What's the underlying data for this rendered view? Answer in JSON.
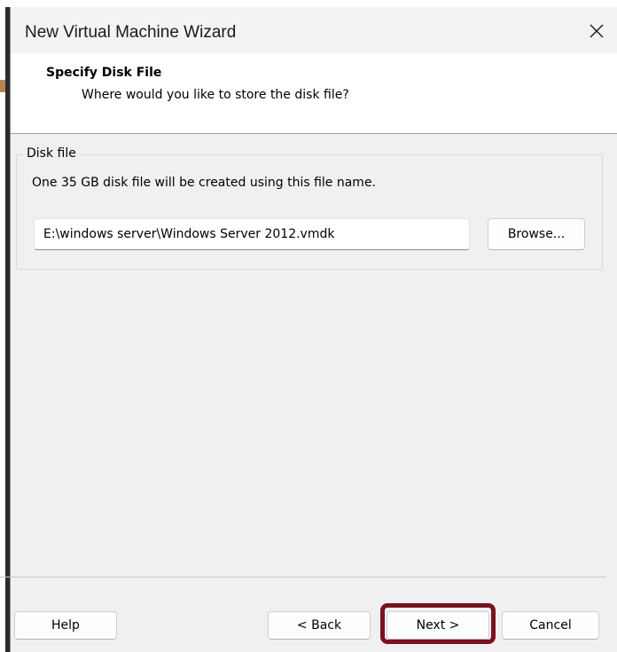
{
  "window": {
    "title": "New Virtual Machine Wizard",
    "close_icon": "close-icon"
  },
  "header": {
    "title": "Specify Disk File",
    "subtitle": "Where would you like to store the disk file?"
  },
  "disk_file": {
    "group_label": "Disk file",
    "description": "One 35 GB disk file will be created using this file name.",
    "path_value": "E:\\windows server\\Windows Server 2012.vmdk",
    "browse_label": "Browse..."
  },
  "footer": {
    "help_label": "Help",
    "back_label": "< Back",
    "next_label": "Next >",
    "cancel_label": "Cancel"
  },
  "colors": {
    "highlight": "#7a1220",
    "dialog_background": "#f0f0f0",
    "header_background": "#ffffff"
  }
}
